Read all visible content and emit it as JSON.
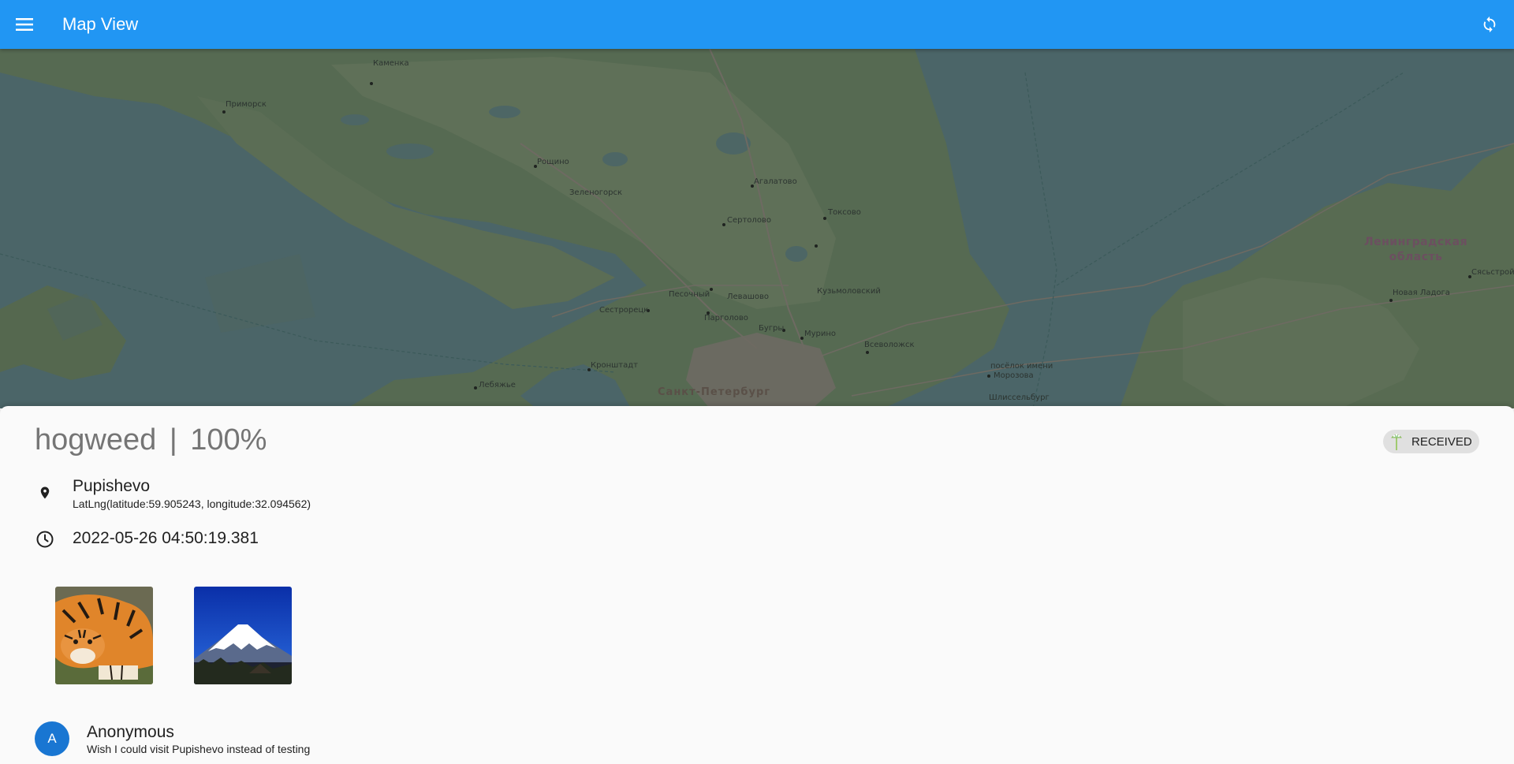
{
  "appbar": {
    "title": "Map View",
    "menu_icon": "menu-icon",
    "sync_icon": "sync-icon",
    "color": "#2196f3"
  },
  "map": {
    "labels": {
      "kamenka": "Каменка",
      "primorsk": "Приморск",
      "roshchino": "Рощино",
      "zelenogorsk": "Зеленогорск",
      "agalatovo": "Агалатово",
      "toksovo": "Токсово",
      "sertolovo": "Сертолово",
      "pesochny": "Песочный",
      "levashovo": "Левашово",
      "kuzmolovsky": "Кузьмоловский",
      "sestroretsk": "Сестрорецк",
      "pargolovo": "Парголово",
      "bugry": "Бугры",
      "murino": "Мурино",
      "vsevolozhsk": "Всеволожск",
      "kronshtadt": "Кронштадт",
      "morozova_1": "посёлок имени",
      "morozova_2": "Морозова",
      "lebyazhye": "Лебяжье",
      "spb": "Санкт-Петербург",
      "shlisselburg": "Шлиссельбург",
      "region_1": "Ленинградская",
      "region_2": "область",
      "novaya_ladoga": "Новая Ладога",
      "syasstroy": "Сясьстрой"
    }
  },
  "detail": {
    "species": "hogweed",
    "separator": "|",
    "confidence": "100%",
    "status": "RECEIVED",
    "status_icon": "hogweed-plant-icon",
    "place_name": "Pupishevo",
    "coords": "LatLng(latitude:59.905243, longitude:32.094562)",
    "timestamp": "2022-05-26 04:50:19.381",
    "photos": [
      "tiger-photo",
      "mount-fuji-photo"
    ],
    "comment": {
      "avatar_letter": "A",
      "author": "Anonymous",
      "text": "Wish I could visit Pupishevo instead of testing"
    }
  }
}
